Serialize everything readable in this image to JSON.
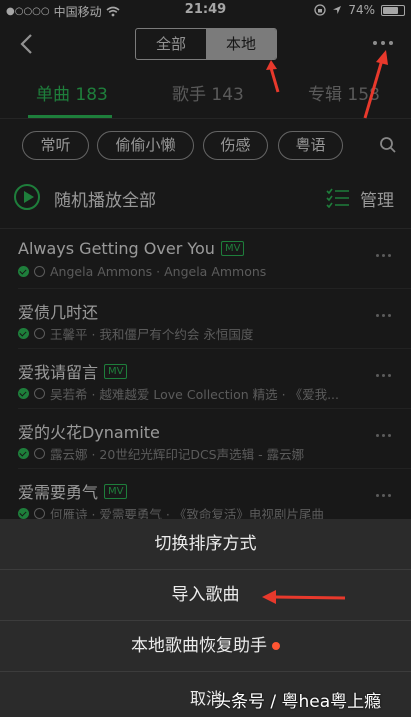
{
  "status_bar": {
    "carrier": "中国移动",
    "time": "21:49",
    "battery": "74%",
    "battery_level": 0.74
  },
  "header": {
    "segments": [
      "全部",
      "本地"
    ],
    "active_segment": "本地"
  },
  "tabs": [
    {
      "label": "单曲 183",
      "active": true
    },
    {
      "label": "歌手 143",
      "active": false
    },
    {
      "label": "专辑 158",
      "active": false
    }
  ],
  "filters": [
    "常听",
    "偷偷小懒",
    "伤感",
    "粤语"
  ],
  "play_all": {
    "label": "随机播放全部",
    "manage_label": "管理"
  },
  "songs": [
    {
      "title": "Always Getting Over You",
      "mv": "MV",
      "subtitle": "Angela Ammons · Angela Ammons"
    },
    {
      "title": "爱债几时还",
      "mv": "",
      "subtitle": "王馨平 · 我和僵尸有个约会 永恒国度"
    },
    {
      "title": "爱我请留言",
      "mv": "MV",
      "subtitle": "吴若希 · 越难越爱 Love Collection 精选 · 《爱我..."
    },
    {
      "title": "爱的火花Dynamite",
      "mv": "",
      "subtitle": "露云娜 · 20世纪光辉印记DCS声选辑 - 露云娜"
    },
    {
      "title": "爱需要勇气",
      "mv": "MV",
      "subtitle": "何雁诗 · 爱需要勇气 · 《致命复活》电视剧片尾曲"
    }
  ],
  "action_sheet": {
    "items": [
      "切换排序方式",
      "导入歌曲",
      "本地歌曲恢复助手"
    ],
    "cancel": "取消"
  },
  "watermark": "头条号 / 粤hea粤上瘾",
  "colors": {
    "accent": "#2fc25b",
    "background": "#262626",
    "annotation": "#e8392c",
    "notice_dot": "#ff5533"
  }
}
